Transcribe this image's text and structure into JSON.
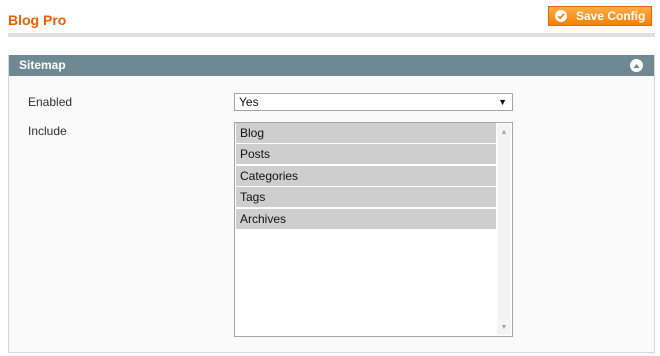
{
  "page": {
    "title": "Blog Pro",
    "save_button_label": "Save Config"
  },
  "section": {
    "title": "Sitemap",
    "collapse_icon": "collapse-up-icon",
    "fields": {
      "enabled": {
        "label": "Enabled",
        "value": "Yes"
      },
      "include": {
        "label": "Include",
        "options": [
          "Blog",
          "Posts",
          "Categories",
          "Tags",
          "Archives"
        ],
        "selected": [
          "Blog",
          "Posts",
          "Categories",
          "Tags",
          "Archives"
        ]
      }
    }
  },
  "colors": {
    "title_orange": "#eb5e00",
    "button_orange": "#f18200",
    "section_header": "#6f8992",
    "selected_item": "#cecece"
  }
}
